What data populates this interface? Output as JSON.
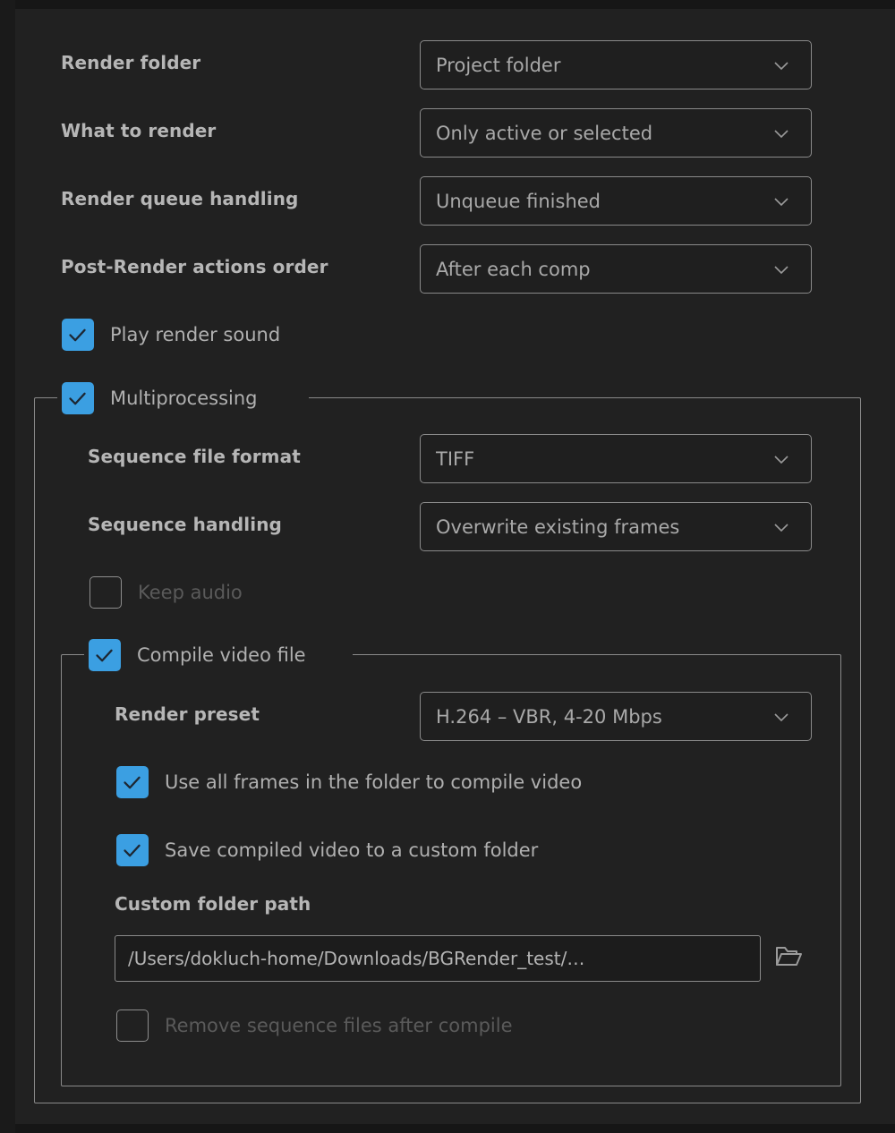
{
  "theme": {
    "background": "#212121",
    "accent": "#3b9fe2",
    "border": "#8a8a8a",
    "label_color": "#b6b6b6",
    "disabled_color": "#5a5a5a"
  },
  "settings": {
    "fields": [
      {
        "label": "Render folder",
        "value": "Project folder",
        "icon": "chevron-down-icon"
      },
      {
        "label": "What to render",
        "value": "Only active or selected",
        "icon": "chevron-down-icon"
      },
      {
        "label": "Render queue handling",
        "value": "Unqueue finished",
        "icon": "chevron-down-icon"
      },
      {
        "label": "Post-Render actions order",
        "value": "After each comp",
        "icon": "chevron-down-icon"
      }
    ],
    "play_render_sound": {
      "label": "Play render sound",
      "checked": true,
      "enabled": true
    }
  },
  "multiprocessing": {
    "legend": {
      "label": "Multiprocessing",
      "checked": true,
      "enabled": true
    },
    "fields": [
      {
        "label": "Sequence file format",
        "value": "TIFF",
        "icon": "chevron-down-icon"
      },
      {
        "label": "Sequence handling",
        "value": "Overwrite existing frames",
        "icon": "chevron-down-icon"
      }
    ],
    "keep_audio": {
      "label": "Keep audio",
      "checked": false,
      "enabled": false
    }
  },
  "compile_video": {
    "legend": {
      "label": "Compile video file",
      "checked": true,
      "enabled": true
    },
    "render_preset": {
      "label": "Render preset",
      "value": "H.264 – VBR, 4-20 Mbps",
      "icon": "chevron-down-icon"
    },
    "use_all_frames": {
      "label": "Use all frames in the folder to compile video",
      "checked": true,
      "enabled": true
    },
    "save_custom_folder": {
      "label": "Save compiled video to a custom folder",
      "checked": true,
      "enabled": true
    },
    "custom_folder_path": {
      "label": "Custom folder path",
      "value": "/Users/dokluch-home/Downloads/BGRender_test/…",
      "placeholder": "Choose a folder",
      "browse_icon": "folder-open-icon"
    },
    "remove_sequence": {
      "label": "Remove sequence files after compile",
      "checked": false,
      "enabled": false
    }
  }
}
